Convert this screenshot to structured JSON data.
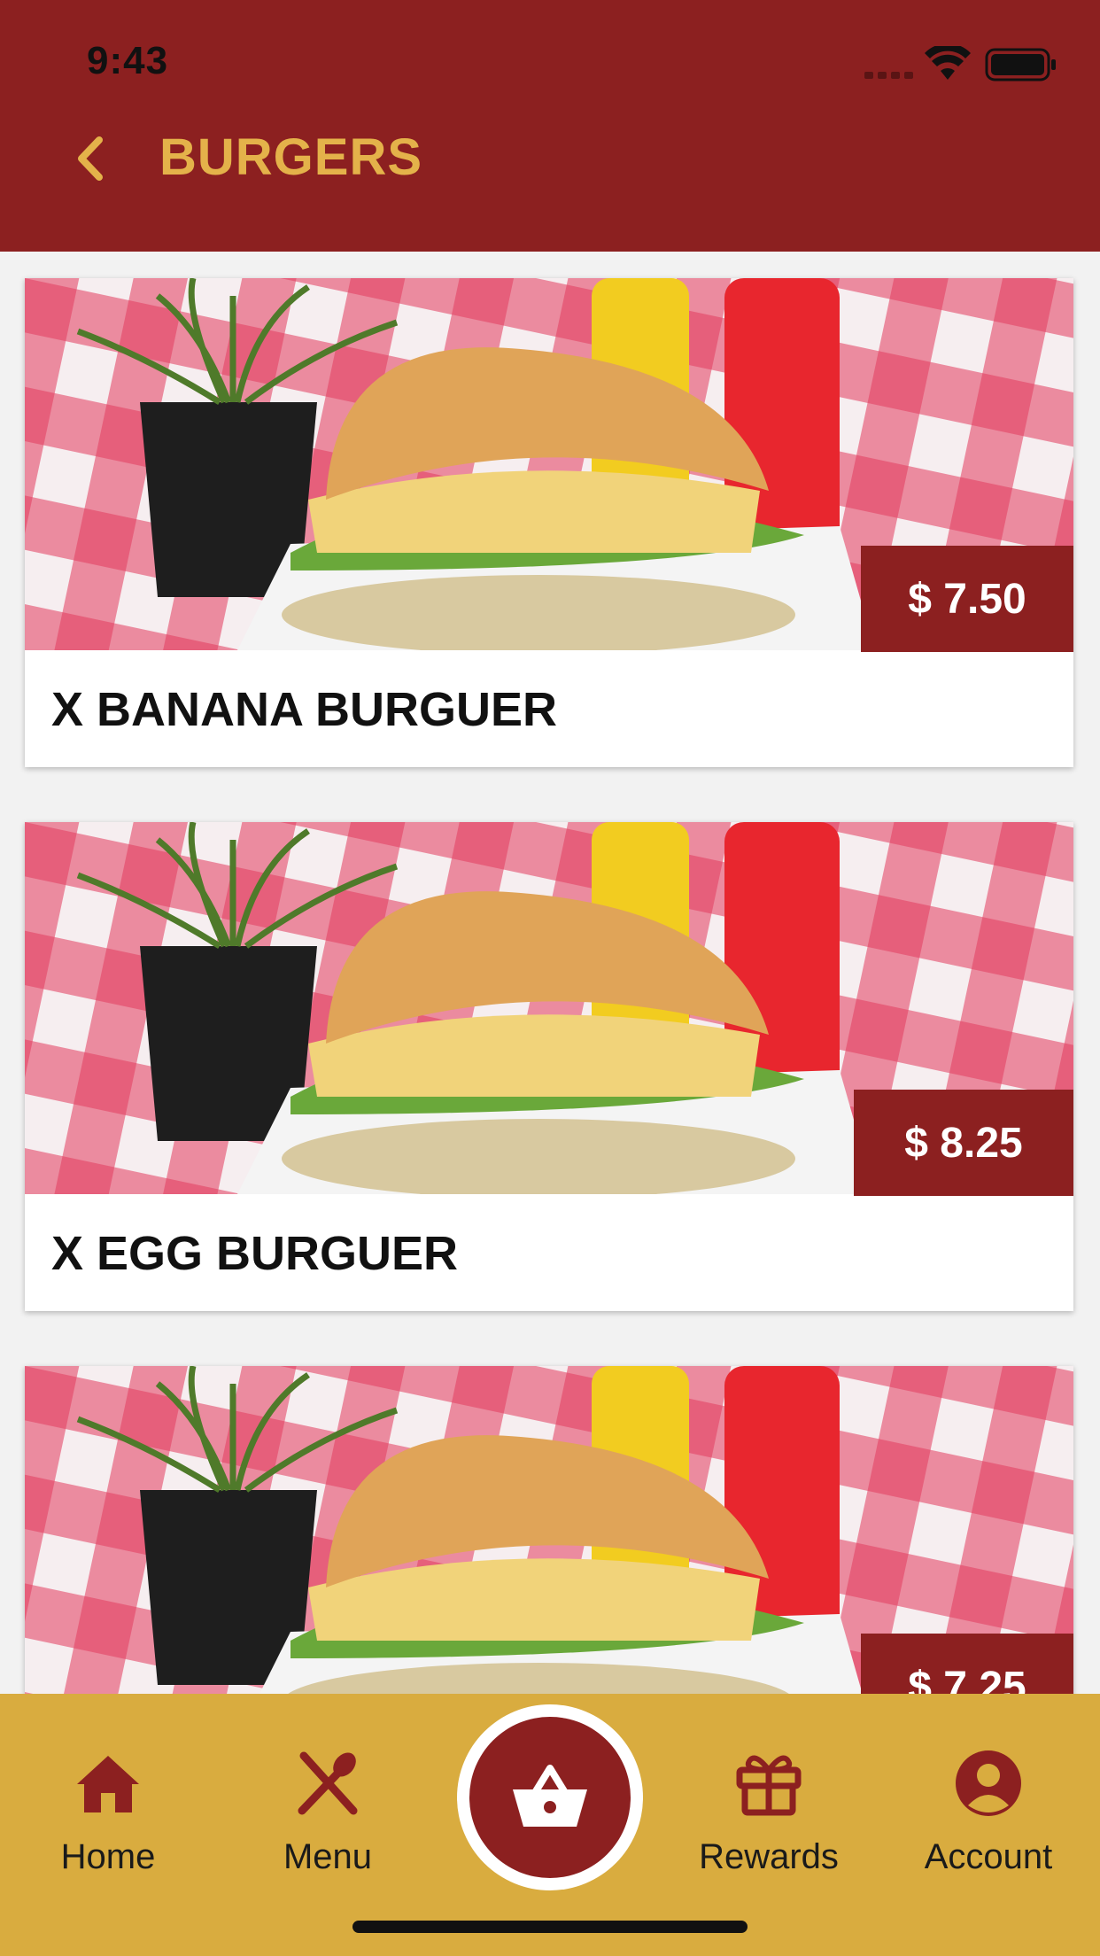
{
  "status_bar": {
    "time": "9:43"
  },
  "header": {
    "title": "BURGERS",
    "back_icon": "chevron-left-icon"
  },
  "products": [
    {
      "name": "X BANANA BURGUER",
      "price": "$ 7.50"
    },
    {
      "name": "X EGG BURGUER",
      "price": "$ 8.25"
    },
    {
      "name": "",
      "price": "$ 7.25"
    }
  ],
  "tabbar": {
    "home": {
      "label": "Home",
      "icon": "home-icon"
    },
    "menu": {
      "label": "Menu",
      "icon": "utensils-icon"
    },
    "cart": {
      "icon": "basket-icon"
    },
    "rewards": {
      "label": "Rewards",
      "icon": "gift-icon"
    },
    "account": {
      "label": "Account",
      "icon": "user-circle-icon"
    }
  },
  "colors": {
    "header_bg": "#8c2020",
    "title": "#e4b24a",
    "tabbar_bg": "#d9ac3f",
    "price_bg": "#8c2020"
  }
}
